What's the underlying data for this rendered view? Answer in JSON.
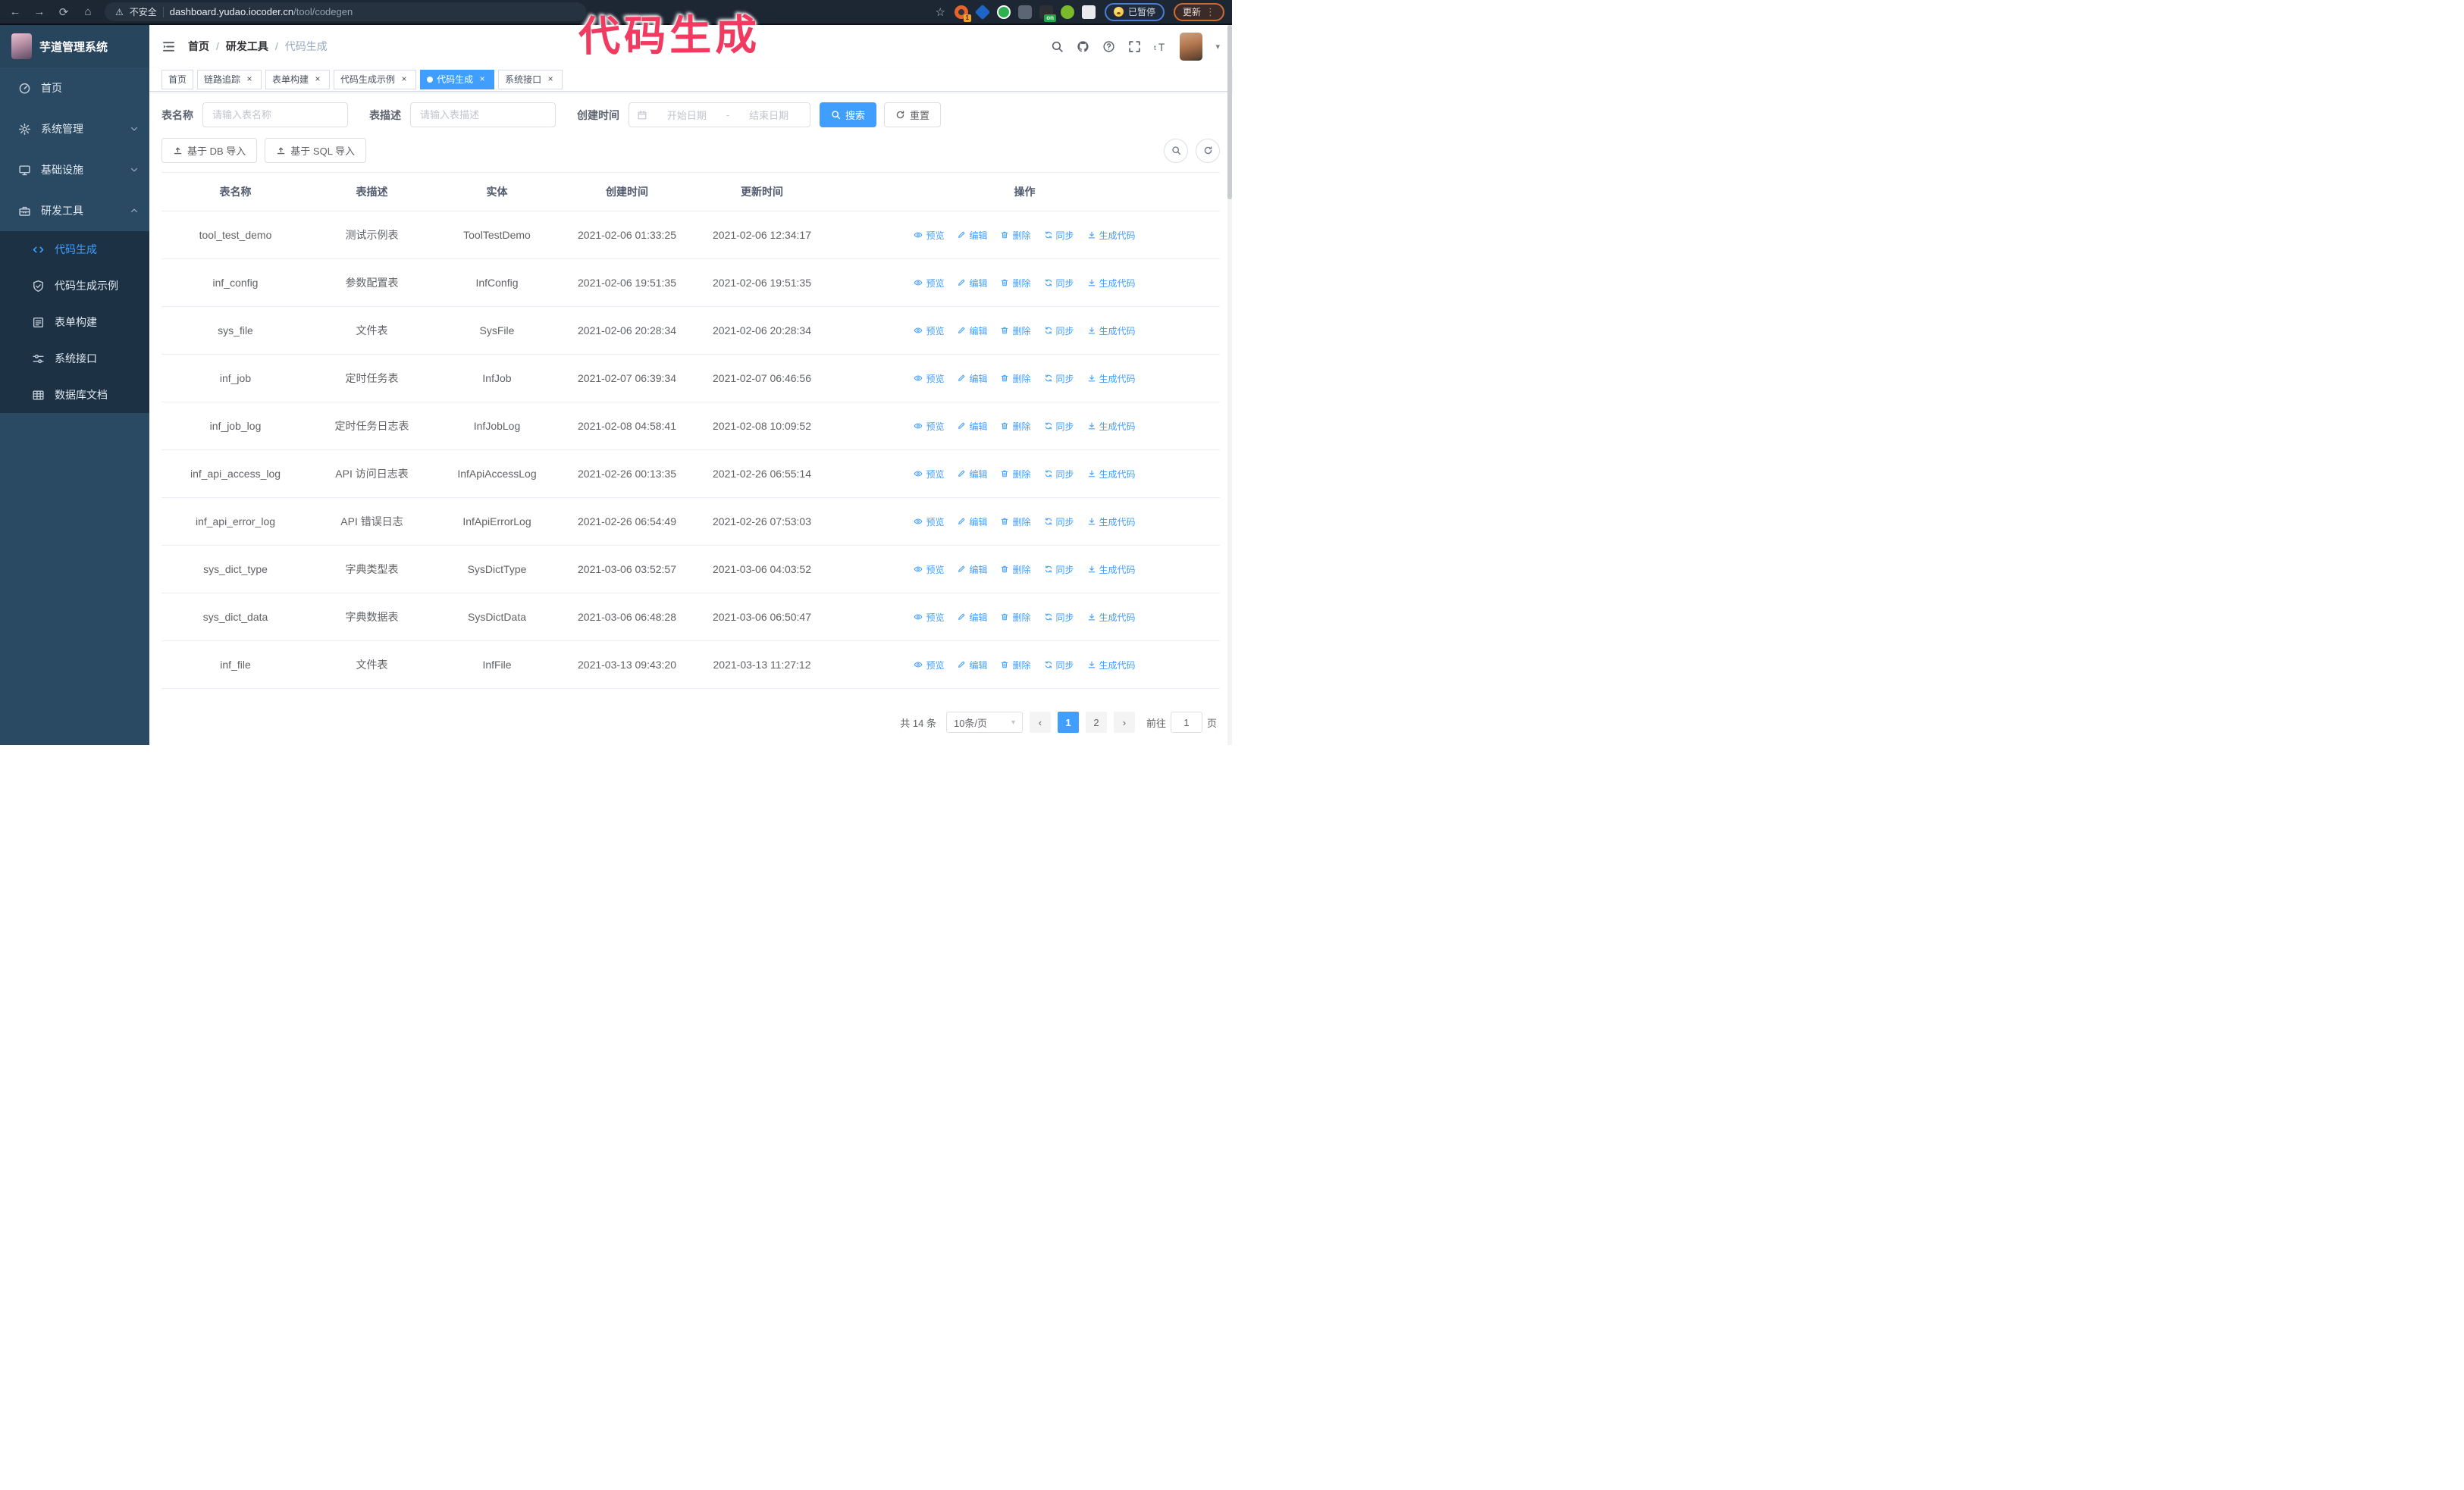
{
  "glyphs": {
    "back": "←",
    "forward": "→",
    "reload": "⟳",
    "home": "⌂",
    "star": "☆",
    "warning": "⚠",
    "dots": "⋮",
    "caret": "▾",
    "prev": "‹",
    "next": "›",
    "close": "×",
    "breadcrumb_sep": "/"
  },
  "browser": {
    "security_warning": "不安全",
    "url_domain": "dashboard.yudao.iocoder.cn",
    "url_path": "/tool/codegen",
    "ext_badge_1": "1",
    "ext_badge_on": "on",
    "paused_label": "已暂停",
    "update_label": "更新"
  },
  "watermark": "代码生成",
  "sidebar": {
    "logo_title": "芋道管理系统",
    "items": [
      {
        "label": "首页",
        "icon": "dashboard-icon"
      },
      {
        "label": "系统管理",
        "icon": "gear-icon",
        "chevron": "down"
      },
      {
        "label": "基础设施",
        "icon": "monitor-icon",
        "chevron": "down"
      },
      {
        "label": "研发工具",
        "icon": "toolbox-icon",
        "chevron": "up",
        "expanded": true
      }
    ],
    "submenu": [
      {
        "label": "代码生成",
        "icon": "code-icon",
        "active": true
      },
      {
        "label": "代码生成示例",
        "icon": "shield-check-icon"
      },
      {
        "label": "表单构建",
        "icon": "form-icon"
      },
      {
        "label": "系统接口",
        "icon": "sliders-icon"
      },
      {
        "label": "数据库文档",
        "icon": "table-grid-icon"
      }
    ]
  },
  "header": {
    "breadcrumb": [
      "首页",
      "研发工具",
      "代码生成"
    ]
  },
  "tabs": [
    {
      "label": "首页",
      "closable": false,
      "active": false
    },
    {
      "label": "链路追踪",
      "closable": true,
      "active": false
    },
    {
      "label": "表单构建",
      "closable": true,
      "active": false
    },
    {
      "label": "代码生成示例",
      "closable": true,
      "active": false
    },
    {
      "label": "代码生成",
      "closable": true,
      "active": true
    },
    {
      "label": "系统接口",
      "closable": true,
      "active": false
    }
  ],
  "filters": {
    "table_name_label": "表名称",
    "table_name_placeholder": "请输入表名称",
    "table_desc_label": "表描述",
    "table_desc_placeholder": "请输入表描述",
    "create_time_label": "创建时间",
    "start_placeholder": "开始日期",
    "range_separator": "-",
    "end_placeholder": "结束日期",
    "search_label": "搜索",
    "reset_label": "重置"
  },
  "toolbar": {
    "import_db_label": "基于 DB 导入",
    "import_sql_label": "基于 SQL 导入"
  },
  "table": {
    "columns": [
      "表名称",
      "表描述",
      "实体",
      "创建时间",
      "更新时间",
      "操作"
    ],
    "actions": [
      "预览",
      "编辑",
      "删除",
      "同步",
      "生成代码"
    ],
    "rows": [
      [
        "tool_test_demo",
        "测试示例表",
        "ToolTestDemo",
        "2021-02-06 01:33:25",
        "2021-02-06 12:34:17"
      ],
      [
        "inf_config",
        "参数配置表",
        "InfConfig",
        "2021-02-06 19:51:35",
        "2021-02-06 19:51:35"
      ],
      [
        "sys_file",
        "文件表",
        "SysFile",
        "2021-02-06 20:28:34",
        "2021-02-06 20:28:34"
      ],
      [
        "inf_job",
        "定时任务表",
        "InfJob",
        "2021-02-07 06:39:34",
        "2021-02-07 06:46:56"
      ],
      [
        "inf_job_log",
        "定时任务日志表",
        "InfJobLog",
        "2021-02-08 04:58:41",
        "2021-02-08 10:09:52"
      ],
      [
        "inf_api_access_log",
        "API 访问日志表",
        "InfApiAccessLog",
        "2021-02-26 00:13:35",
        "2021-02-26 06:55:14"
      ],
      [
        "inf_api_error_log",
        "API 错误日志",
        "InfApiErrorLog",
        "2021-02-26 06:54:49",
        "2021-02-26 07:53:03"
      ],
      [
        "sys_dict_type",
        "字典类型表",
        "SysDictType",
        "2021-03-06 03:52:57",
        "2021-03-06 04:03:52"
      ],
      [
        "sys_dict_data",
        "字典数据表",
        "SysDictData",
        "2021-03-06 06:48:28",
        "2021-03-06 06:50:47"
      ],
      [
        "inf_file",
        "文件表",
        "InfFile",
        "2021-03-13 09:43:20",
        "2021-03-13 11:27:12"
      ]
    ]
  },
  "pagination": {
    "total_text": "共 14 条",
    "page_size": "10条/页",
    "pages": [
      "1",
      "2"
    ],
    "active_page": "1",
    "goto_label": "前往",
    "goto_value": "1",
    "goto_suffix": "页"
  },
  "colors": {
    "primary": "#409eff",
    "sidebar_bg": "#2a4a63",
    "submenu_bg": "#1c3144",
    "browser_bar": "#1d2633",
    "watermark_pink": "#f23a60"
  }
}
